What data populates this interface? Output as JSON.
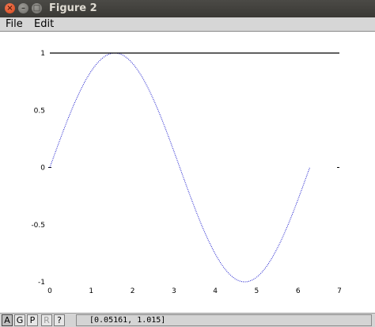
{
  "window": {
    "title": "Figure 2"
  },
  "menu": {
    "file": "File",
    "edit": "Edit"
  },
  "toolbar": {
    "a": "A",
    "g": "G",
    "p": "P",
    "r": "R",
    "help": "?"
  },
  "status": {
    "coords": "[0.05161, 1.015]"
  },
  "chart_data": {
    "type": "line",
    "title": "",
    "xlabel": "",
    "ylabel": "",
    "xlim": [
      0,
      7
    ],
    "ylim": [
      -1,
      1
    ],
    "xticks": [
      "0",
      "1",
      "2",
      "3",
      "4",
      "5",
      "6",
      "7"
    ],
    "yticks": [
      "1",
      "0.5",
      "0",
      "-0.5",
      "-1"
    ],
    "grid": false,
    "series": [
      {
        "style": "dotted",
        "color": "#2a2ad0",
        "function": "sin(x)",
        "x_range": [
          0,
          6.2832
        ]
      },
      {
        "style": "solid",
        "color": "#000000",
        "x": [
          0,
          7
        ],
        "y": [
          1,
          1
        ]
      }
    ]
  }
}
